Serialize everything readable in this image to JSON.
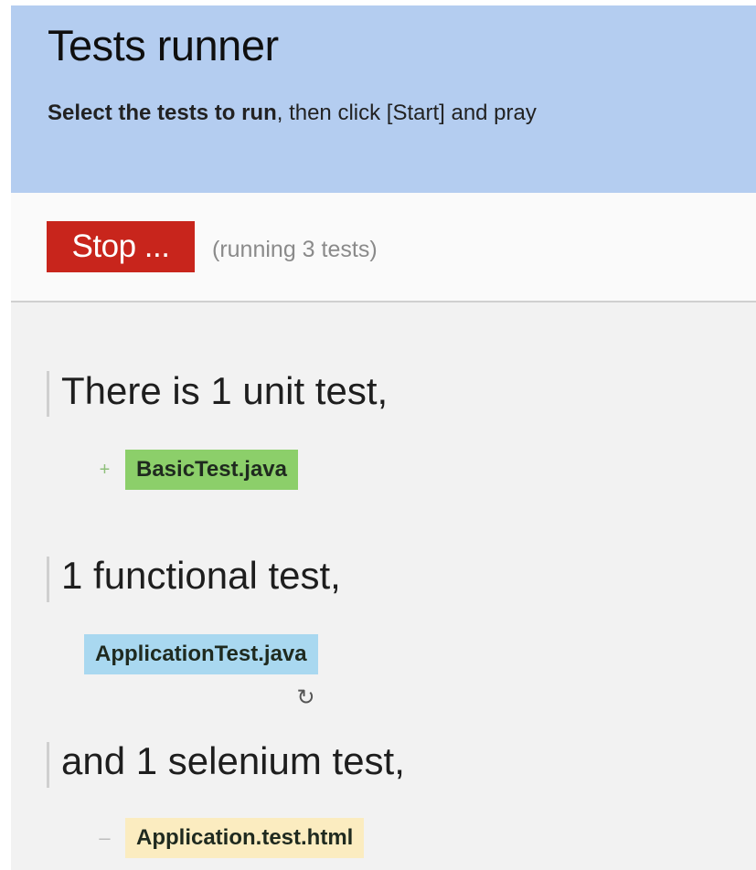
{
  "header": {
    "title": "Tests runner",
    "subtitle_bold": "Select the tests to run",
    "subtitle_rest": ", then click [Start] and pray"
  },
  "toolbar": {
    "stop_label": "Stop ...",
    "status_text": "(running 3 tests)"
  },
  "colors": {
    "header_bg": "#b4cdf0",
    "stop_button": "#c8251c",
    "passed": "#8ccf6a",
    "running": "#a9d8f0",
    "pending": "#fbecc0"
  },
  "sections": [
    {
      "heading": "There is 1 unit test,",
      "tests": [
        {
          "name": "BasicTest.java",
          "status": "passed",
          "icon": "plus-icon",
          "glyph": "+"
        }
      ]
    },
    {
      "heading": "1 functional test,",
      "tests": [
        {
          "name": "ApplicationTest.java",
          "status": "running",
          "icon": "refresh-icon",
          "glyph": "↻"
        }
      ]
    },
    {
      "heading": "and 1 selenium test,",
      "tests": [
        {
          "name": "Application.test.html",
          "status": "pending",
          "icon": "dash-icon",
          "glyph": "–"
        }
      ]
    }
  ]
}
